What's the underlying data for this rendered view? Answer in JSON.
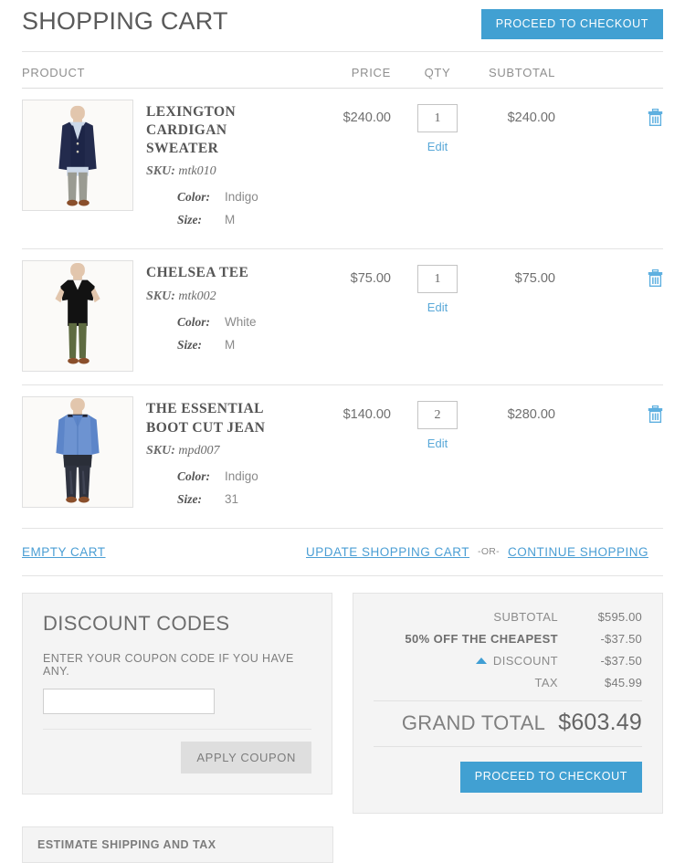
{
  "header": {
    "title": "SHOPPING CART",
    "checkout_button": "PROCEED TO CHECKOUT"
  },
  "table": {
    "columns": {
      "product": "PRODUCT",
      "price": "PRICE",
      "qty": "QTY",
      "subtotal": "SUBTOTAL"
    },
    "option_labels": {
      "color": "Color:",
      "size": "Size:"
    },
    "sku_label": "SKU:",
    "edit_label": "Edit",
    "remove_icon": "trash-icon",
    "rows": [
      {
        "name": "LEXINGTON CARDIGAN SWEATER",
        "sku": "mtk010",
        "color": "Indigo",
        "size": "M",
        "price": "$240.00",
        "qty": "1",
        "subtotal": "$240.00",
        "image_alt": "navy-cardigan-sweater"
      },
      {
        "name": "CHELSEA TEE",
        "sku": "mtk002",
        "color": "White",
        "size": "M",
        "price": "$75.00",
        "qty": "1",
        "subtotal": "$75.00",
        "image_alt": "black-v-neck-tee"
      },
      {
        "name": "THE ESSENTIAL BOOT CUT JEAN",
        "sku": "mpd007",
        "color": "Indigo",
        "size": "31",
        "price": "$140.00",
        "qty": "2",
        "subtotal": "$280.00",
        "image_alt": "blue-shirt-boot-cut-jean"
      }
    ]
  },
  "actions": {
    "empty_cart": "EMPTY CART",
    "update_cart": "UPDATE SHOPPING CART",
    "separator": "-OR-",
    "continue_shopping": "CONTINUE SHOPPING"
  },
  "discount": {
    "title": "DISCOUNT CODES",
    "subtitle": "ENTER YOUR COUPON CODE IF YOU HAVE ANY.",
    "input_value": "",
    "input_placeholder": "",
    "apply_button": "APPLY COUPON"
  },
  "shipping": {
    "title": "ESTIMATE SHIPPING AND TAX"
  },
  "totals": {
    "rows": [
      {
        "label": "SUBTOTAL",
        "value": "$595.00",
        "bold": false,
        "has_toggle": false
      },
      {
        "label": "50% OFF THE CHEAPEST",
        "value": "-$37.50",
        "bold": true,
        "has_toggle": false
      },
      {
        "label": "DISCOUNT",
        "value": "-$37.50",
        "bold": false,
        "has_toggle": true
      },
      {
        "label": "TAX",
        "value": "$45.99",
        "bold": false,
        "has_toggle": false
      }
    ],
    "grand_label": "GRAND TOTAL",
    "grand_value": "$603.49",
    "checkout_button": "PROCEED TO CHECKOUT"
  },
  "colors": {
    "accent_blue": "#41a0d2",
    "link_blue": "#4a9ed4",
    "panel_bg": "#f4f4f4",
    "text_grey": "#636363"
  }
}
